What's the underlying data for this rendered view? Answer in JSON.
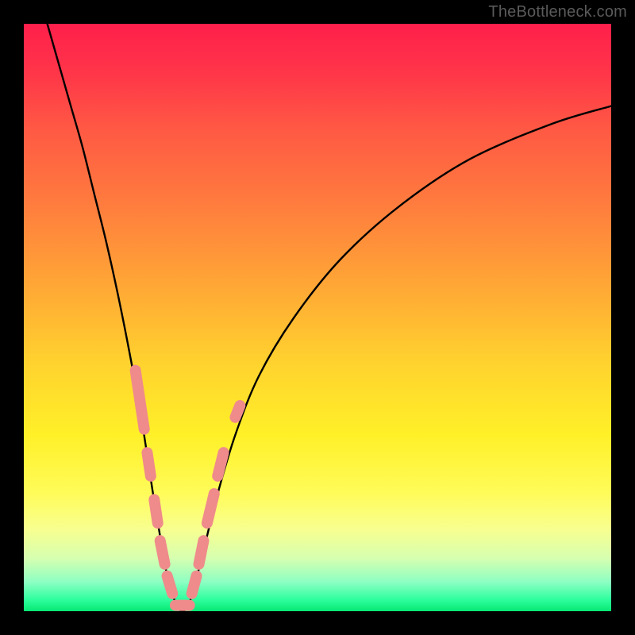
{
  "watermark": "TheBottleneck.com",
  "chart_data": {
    "type": "line",
    "title": "",
    "xlabel": "",
    "ylabel": "",
    "xlim": [
      0,
      100
    ],
    "ylim": [
      0,
      100
    ],
    "grid": false,
    "legend": false,
    "description": "Bottleneck percentage curve: V-shaped curve over a vertical red-to-green gradient; minimum (0% bottleneck) around x≈27% of horizontal axis; pink marker segments overlay curve near the minimum.",
    "series": [
      {
        "name": "bottleneck-curve",
        "x": [
          4,
          6,
          8,
          10,
          12,
          14,
          16,
          18,
          20,
          22,
          23,
          24,
          25,
          26,
          27,
          28,
          29,
          30,
          31,
          33,
          36,
          40,
          46,
          54,
          64,
          76,
          90,
          100
        ],
        "y": [
          100,
          93,
          86,
          79,
          71,
          63,
          54,
          44,
          33,
          20,
          14,
          8,
          4,
          1,
          0,
          1,
          4,
          8,
          12,
          20,
          30,
          40,
          50,
          60,
          69,
          77,
          83,
          86
        ]
      }
    ],
    "markers": [
      {
        "name": "left-band-1",
        "x1": 19.0,
        "y1": 41,
        "x2": 20.5,
        "y2": 31
      },
      {
        "name": "left-band-2",
        "x1": 21.0,
        "y1": 27,
        "x2": 21.6,
        "y2": 23
      },
      {
        "name": "left-band-3",
        "x1": 22.2,
        "y1": 19,
        "x2": 22.8,
        "y2": 15
      },
      {
        "name": "left-band-4",
        "x1": 23.2,
        "y1": 12,
        "x2": 24.0,
        "y2": 8
      },
      {
        "name": "left-band-5",
        "x1": 24.4,
        "y1": 6,
        "x2": 25.3,
        "y2": 3
      },
      {
        "name": "bottom-band",
        "x1": 25.8,
        "y1": 1,
        "x2": 28.2,
        "y2": 1
      },
      {
        "name": "right-band-1",
        "x1": 28.6,
        "y1": 3,
        "x2": 29.4,
        "y2": 6
      },
      {
        "name": "right-band-2",
        "x1": 29.8,
        "y1": 8,
        "x2": 30.6,
        "y2": 12
      },
      {
        "name": "right-band-3",
        "x1": 31.2,
        "y1": 15,
        "x2": 32.4,
        "y2": 20
      },
      {
        "name": "right-band-4",
        "x1": 33.0,
        "y1": 23,
        "x2": 34.0,
        "y2": 27
      },
      {
        "name": "right-dot",
        "x1": 36.0,
        "y1": 33,
        "x2": 36.8,
        "y2": 35
      }
    ]
  }
}
